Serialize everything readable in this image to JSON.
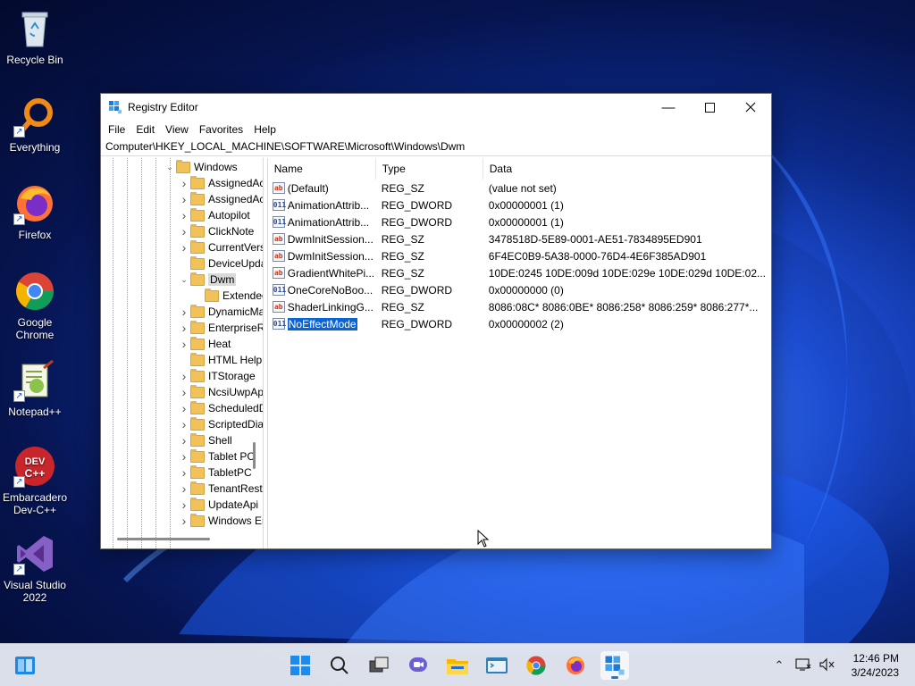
{
  "desktop": {
    "icons": [
      {
        "label": "Recycle Bin",
        "icon": "recycle-bin-icon"
      },
      {
        "label": "Everything",
        "icon": "everything-search-icon"
      },
      {
        "label": "Firefox",
        "icon": "firefox-icon"
      },
      {
        "label": "Google Chrome",
        "icon": "chrome-icon"
      },
      {
        "label": "Notepad++",
        "icon": "notepad-plus-plus-icon"
      },
      {
        "label": "Embarcadero Dev-C++",
        "icon": "dev-cpp-icon"
      },
      {
        "label": "Visual Studio 2022",
        "icon": "visual-studio-icon"
      }
    ]
  },
  "window": {
    "title": "Registry Editor",
    "menu": [
      "File",
      "Edit",
      "View",
      "Favorites",
      "Help"
    ],
    "address": "Computer\\HKEY_LOCAL_MACHINE\\SOFTWARE\\Microsoft\\Windows\\Dwm",
    "tree": {
      "items": [
        {
          "label": "Windows",
          "expanded": true,
          "level": 0
        },
        {
          "label": "AssignedAcce",
          "level": 1,
          "has_children": true
        },
        {
          "label": "AssignedAcce",
          "level": 1,
          "has_children": true
        },
        {
          "label": "Autopilot",
          "level": 1,
          "has_children": true
        },
        {
          "label": "ClickNote",
          "level": 1,
          "has_children": true
        },
        {
          "label": "CurrentVersion",
          "level": 1,
          "has_children": true
        },
        {
          "label": "DeviceUpdate",
          "level": 1,
          "has_children": false
        },
        {
          "label": "Dwm",
          "level": 1,
          "expanded": true,
          "selected": true
        },
        {
          "label": "ExtendedC",
          "level": 2,
          "has_children": false
        },
        {
          "label": "DynamicMana",
          "level": 1,
          "has_children": true
        },
        {
          "label": "EnterpriseReso",
          "level": 1,
          "has_children": true
        },
        {
          "label": "Heat",
          "level": 1,
          "has_children": true
        },
        {
          "label": "HTML Help",
          "level": 1,
          "has_children": false
        },
        {
          "label": "ITStorage",
          "level": 1,
          "has_children": true
        },
        {
          "label": "NcsiUwpApp",
          "level": 1,
          "has_children": true
        },
        {
          "label": "ScheduledDiag",
          "level": 1,
          "has_children": true
        },
        {
          "label": "ScriptedDiagn",
          "level": 1,
          "has_children": true
        },
        {
          "label": "Shell",
          "level": 1,
          "has_children": true
        },
        {
          "label": "Tablet PC",
          "level": 1,
          "has_children": true
        },
        {
          "label": "TabletPC",
          "level": 1,
          "has_children": true
        },
        {
          "label": "TenantRestrict",
          "level": 1,
          "has_children": true
        },
        {
          "label": "UpdateApi",
          "level": 1,
          "has_children": true
        },
        {
          "label": "Windows Error",
          "level": 1,
          "has_children": true
        }
      ]
    },
    "list": {
      "headers": {
        "name": "Name",
        "type": "Type",
        "data": "Data"
      },
      "rows": [
        {
          "icon": "ab",
          "kind": "sz",
          "name": "(Default)",
          "type": "REG_SZ",
          "data": "(value not set)"
        },
        {
          "icon": "011",
          "kind": "dw",
          "name": "AnimationAttrib...",
          "type": "REG_DWORD",
          "data": "0x00000001 (1)"
        },
        {
          "icon": "011",
          "kind": "dw",
          "name": "AnimationAttrib...",
          "type": "REG_DWORD",
          "data": "0x00000001 (1)"
        },
        {
          "icon": "ab",
          "kind": "sz",
          "name": "DwmInitSession...",
          "type": "REG_SZ",
          "data": "3478518D-5E89-0001-AE51-7834895ED901"
        },
        {
          "icon": "ab",
          "kind": "sz",
          "name": "DwmInitSession...",
          "type": "REG_SZ",
          "data": "6F4EC0B9-5A38-0000-76D4-4E6F385AD901"
        },
        {
          "icon": "ab",
          "kind": "sz",
          "name": "GradientWhitePi...",
          "type": "REG_SZ",
          "data": "10DE:0245 10DE:009d 10DE:029e 10DE:029d 10DE:02..."
        },
        {
          "icon": "011",
          "kind": "dw",
          "name": "OneCoreNoBoo...",
          "type": "REG_DWORD",
          "data": "0x00000000 (0)"
        },
        {
          "icon": "ab",
          "kind": "sz",
          "name": "ShaderLinkingG...",
          "type": "REG_SZ",
          "data": "8086:08C* 8086:0BE* 8086:258* 8086:259* 8086:277*..."
        },
        {
          "icon": "011",
          "kind": "dw",
          "name": "NoEffectMode",
          "type": "REG_DWORD",
          "data": "0x00000002 (2)",
          "selected": true
        }
      ]
    }
  },
  "taskbar": {
    "apps": [
      "start-icon",
      "search-icon",
      "task-view-icon",
      "chat-icon",
      "file-explorer-icon",
      "terminal-icon",
      "chrome-icon",
      "firefox-icon",
      "registry-editor-icon"
    ],
    "time": "12:46 PM",
    "date": "3/24/2023"
  }
}
